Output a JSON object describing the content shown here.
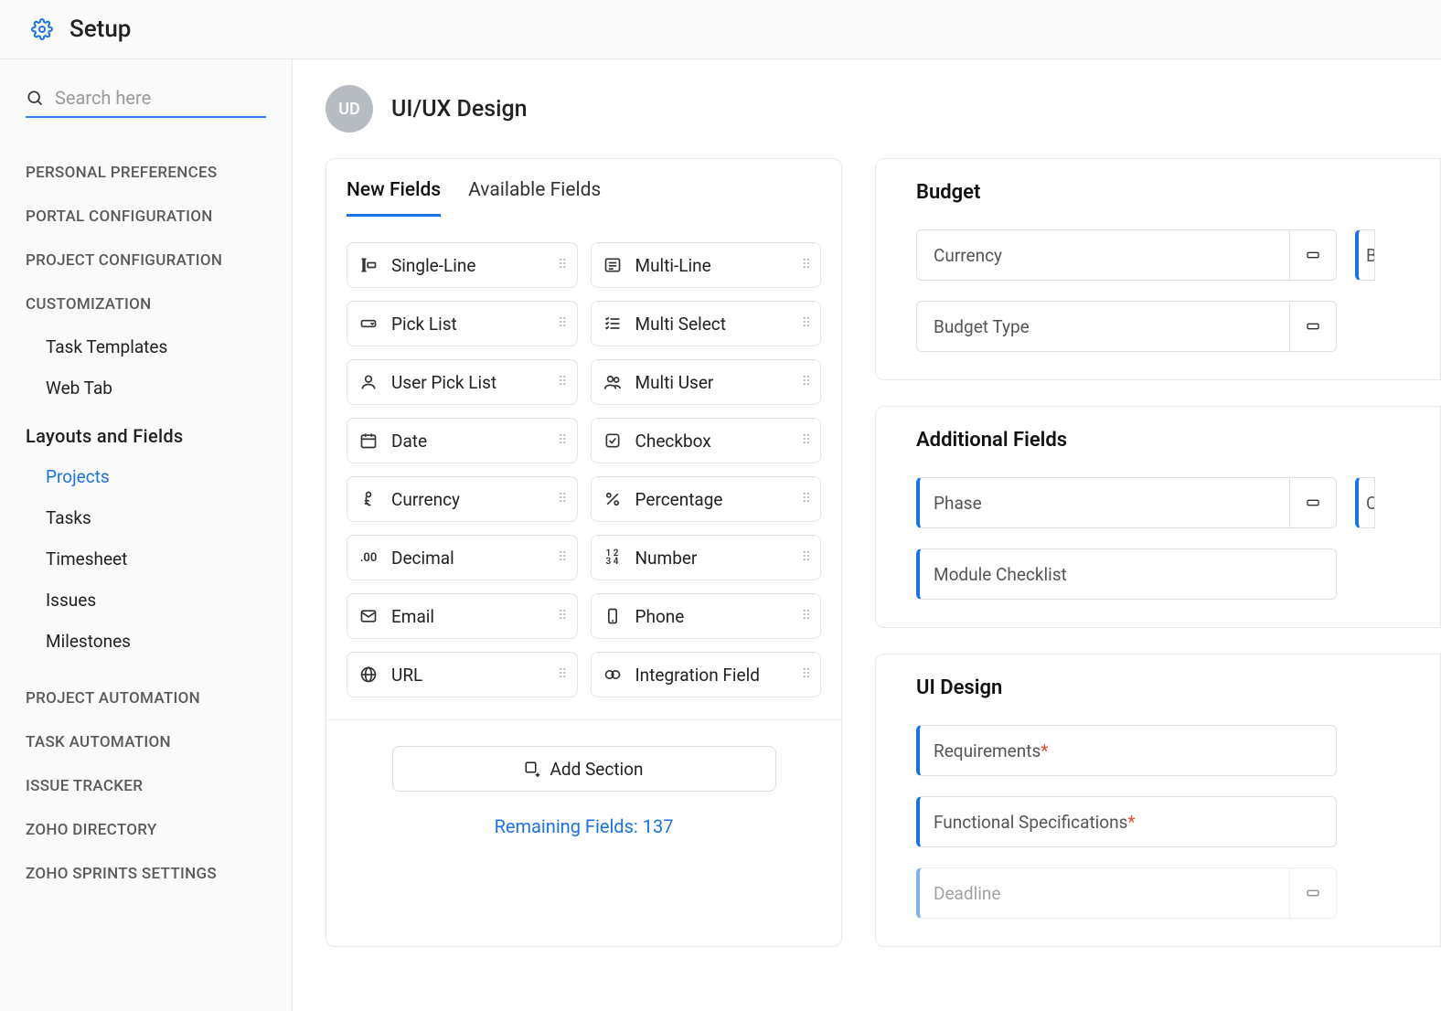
{
  "header": {
    "title": "Setup"
  },
  "sidebar": {
    "search_placeholder": "Search here",
    "sections": [
      {
        "label": "PERSONAL PREFERENCES"
      },
      {
        "label": "PORTAL CONFIGURATION"
      },
      {
        "label": "PROJECT CONFIGURATION"
      },
      {
        "label": "CUSTOMIZATION",
        "children": [
          "Task Templates",
          "Web Tab"
        ]
      },
      {
        "label": "Layouts and Fields",
        "expanded": true,
        "children": [
          "Projects",
          "Tasks",
          "Timesheet",
          "Issues",
          "Milestones"
        ],
        "active_child": "Projects"
      },
      {
        "label": "PROJECT AUTOMATION"
      },
      {
        "label": "TASK AUTOMATION"
      },
      {
        "label": "ISSUE TRACKER"
      },
      {
        "label": "ZOHO DIRECTORY"
      },
      {
        "label": "ZOHO SPRINTS SETTINGS"
      }
    ]
  },
  "project": {
    "initials": "UD",
    "name": "UI/UX Design"
  },
  "tabs": {
    "new": "New Fields",
    "available": "Available Fields"
  },
  "field_types": [
    "Single-Line",
    "Multi-Line",
    "Pick List",
    "Multi Select",
    "User Pick List",
    "Multi User",
    "Date",
    "Checkbox",
    "Currency",
    "Percentage",
    "Decimal",
    "Number",
    "Email",
    "Phone",
    "URL",
    "Integration Field"
  ],
  "add_section_label": "Add Section",
  "remaining_label": "Remaining Fields: 137",
  "right_sections": [
    {
      "title": "Budget",
      "rows": [
        [
          {
            "label": "Currency",
            "icon": true
          },
          {
            "label": "B",
            "peek": true
          }
        ],
        [
          {
            "label": "Budget Type",
            "icon": true
          }
        ]
      ]
    },
    {
      "title": "Additional Fields",
      "rows": [
        [
          {
            "label": "Phase",
            "accent": true,
            "icon": true
          },
          {
            "label": "C",
            "peek": true,
            "accent": true
          }
        ],
        [
          {
            "label": "Module Checklist",
            "accent": true
          }
        ]
      ]
    },
    {
      "title": "UI Design",
      "rows": [
        [
          {
            "label": "Requirements",
            "required": true,
            "accent": true
          }
        ],
        [
          {
            "label": "Functional Specifications",
            "required": true,
            "accent": true
          }
        ],
        [
          {
            "label": "Deadline",
            "accent": true,
            "icon": true,
            "faded": true
          }
        ]
      ]
    }
  ]
}
